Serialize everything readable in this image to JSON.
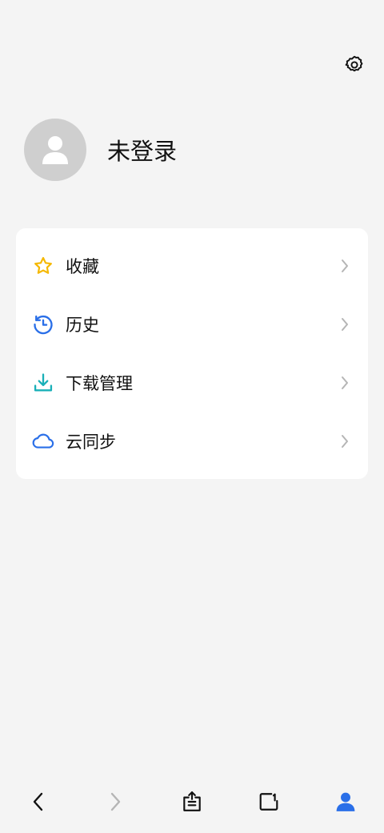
{
  "header": {
    "settings_icon": "gear-icon"
  },
  "profile": {
    "avatar_icon": "user-silhouette-icon",
    "login_label": "未登录"
  },
  "menu": {
    "items": [
      {
        "label": "收藏",
        "icon": "star-icon",
        "color": "#f5b800"
      },
      {
        "label": "历史",
        "icon": "history-clock-icon",
        "color": "#2a6fe8"
      },
      {
        "label": "下载管理",
        "icon": "download-icon",
        "color": "#1ab0b8"
      },
      {
        "label": "云同步",
        "icon": "cloud-icon",
        "color": "#2a6fe8"
      }
    ],
    "chevron_icon": "chevron-right-icon"
  },
  "bottom_nav": {
    "items": [
      {
        "icon": "back-arrow-icon"
      },
      {
        "icon": "forward-arrow-icon"
      },
      {
        "icon": "share-icon"
      },
      {
        "icon": "tabs-icon"
      },
      {
        "icon": "profile-icon",
        "active_color": "#2a6fe8"
      }
    ]
  }
}
